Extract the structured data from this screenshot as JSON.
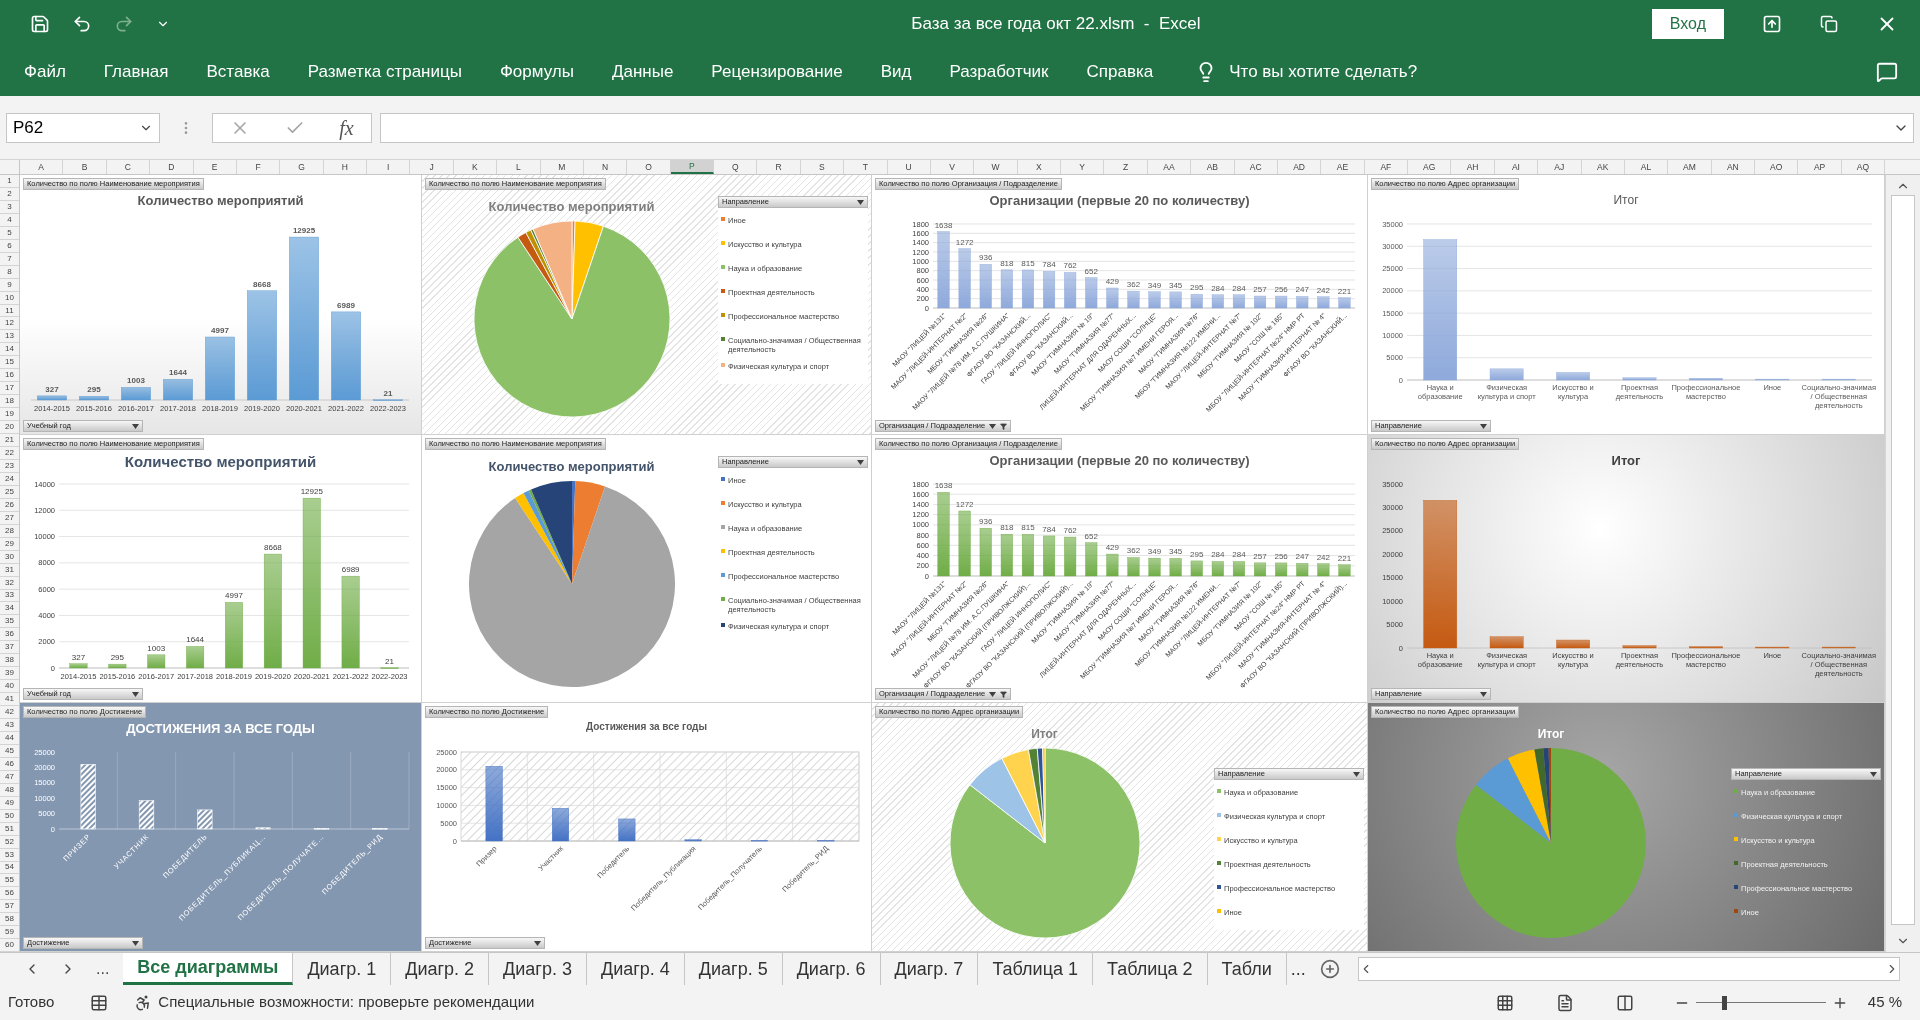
{
  "window": {
    "title": "База за все года окт 22.xlsm  -  Excel",
    "sign_in": "Вход"
  },
  "ribbon_tabs": [
    "Файл",
    "Главная",
    "Вставка",
    "Разметка страницы",
    "Формулы",
    "Данные",
    "Рецензирование",
    "Вид",
    "Разработчик",
    "Справка"
  ],
  "tell_me": "Что вы хотите сделать?",
  "name_box": "P62",
  "fx_label": "fx",
  "columns": [
    {
      "label": "A",
      "selected": false
    },
    {
      "label": "B",
      "selected": false
    },
    {
      "label": "C",
      "selected": false
    },
    {
      "label": "D",
      "selected": false
    },
    {
      "label": "E",
      "selected": false
    },
    {
      "label": "F",
      "selected": false
    },
    {
      "label": "G",
      "selected": false
    },
    {
      "label": "H",
      "selected": false
    },
    {
      "label": "I",
      "selected": false
    },
    {
      "label": "J",
      "selected": false
    },
    {
      "label": "K",
      "selected": false
    },
    {
      "label": "L",
      "selected": false
    },
    {
      "label": "M",
      "selected": false
    },
    {
      "label": "N",
      "selected": false
    },
    {
      "label": "O",
      "selected": false
    },
    {
      "label": "P",
      "selected": true
    },
    {
      "label": "Q",
      "selected": false
    },
    {
      "label": "R",
      "selected": false
    },
    {
      "label": "S",
      "selected": false
    },
    {
      "label": "T",
      "selected": false
    },
    {
      "label": "U",
      "selected": false
    },
    {
      "label": "V",
      "selected": false
    },
    {
      "label": "W",
      "selected": false
    },
    {
      "label": "X",
      "selected": false
    },
    {
      "label": "Y",
      "selected": false
    },
    {
      "label": "Z",
      "selected": false
    },
    {
      "label": "AA",
      "selected": false
    },
    {
      "label": "AB",
      "selected": false
    },
    {
      "label": "AC",
      "selected": false
    },
    {
      "label": "AD",
      "selected": false
    },
    {
      "label": "AE",
      "selected": false
    },
    {
      "label": "AF",
      "selected": false
    },
    {
      "label": "AG",
      "selected": false
    },
    {
      "label": "AH",
      "selected": false
    },
    {
      "label": "AI",
      "selected": false
    },
    {
      "label": "AJ",
      "selected": false
    },
    {
      "label": "AK",
      "selected": false
    },
    {
      "label": "AL",
      "selected": false
    },
    {
      "label": "AM",
      "selected": false
    },
    {
      "label": "AN",
      "selected": false
    },
    {
      "label": "AO",
      "selected": false
    },
    {
      "label": "AP",
      "selected": false
    },
    {
      "label": "AQ",
      "selected": false
    }
  ],
  "rows": [
    "1",
    "2",
    "3",
    "4",
    "5",
    "6",
    "7",
    "8",
    "9",
    "10",
    "11",
    "12",
    "13",
    "14",
    "15",
    "16",
    "17",
    "18",
    "19",
    "20",
    "21",
    "22",
    "23",
    "24",
    "25",
    "26",
    "27",
    "28",
    "29",
    "30",
    "31",
    "32",
    "33",
    "34",
    "35",
    "36",
    "37",
    "38",
    "39",
    "40",
    "41",
    "42",
    "43",
    "44",
    "45",
    "46",
    "47",
    "48",
    "49",
    "50",
    "51",
    "52",
    "53",
    "54",
    "55",
    "56",
    "57",
    "58",
    "59",
    "60"
  ],
  "charts": [
    {
      "kind": "yearbars",
      "field_button": "Количество по полю Наименование мероприятия",
      "title": "Количество мероприятий",
      "axis_button": "Учебный год",
      "chart_data": {
        "type": "bar",
        "categories": [
          "2014-2015",
          "2015-2016",
          "2016-2017",
          "2017-2018",
          "2018-2019",
          "2019-2020",
          "2020-2021",
          "2021-2022",
          "2022-2023"
        ],
        "series": [
          {
            "color": "#5b9bd5",
            "values": [
              327,
              295,
              1003,
              1644,
              4997,
              8668,
              12925,
              6989,
              21
            ]
          }
        ],
        "data_labels": true
      }
    },
    {
      "kind": "piewarm",
      "field_button": "Количество по полю Наименование мероприятия",
      "title": "Количество мероприятий",
      "legend": {
        "title": "Направление",
        "items": [
          {
            "label": "Иное",
            "color": "#ed7d31"
          },
          {
            "label": "Искусство и культура",
            "color": "#ffc000"
          },
          {
            "label": "Наука и образование",
            "color": "#8cc168"
          },
          {
            "label": "Проектная деятельность",
            "color": "#c55a11"
          },
          {
            "label": "Профессиональное мастерство",
            "color": "#bf9000"
          },
          {
            "label": "Социально-значимая / Общественная деятельность",
            "color": "#548235"
          },
          {
            "label": "Физическая культура и спорт",
            "color": "#f4b183"
          }
        ]
      }
    },
    {
      "kind": "orgbars",
      "field_button": "Количество по полю Организация / Подразделение",
      "title": "Организации (первые 20 по количеству)",
      "axis_button": "Организация / Подразделение",
      "chart_data": {
        "type": "bar",
        "categories": [
          "МАОУ \"ЛИЦЕЙ №131\"",
          "МАОУ \"ЛИЦЕЙ-ИНТЕРНАТ №2\"",
          "МБОУ \"ГИМНАЗИЯ №26\"",
          "МАОУ \"ЛИЦЕЙ №78 ИМ. А.С.ПУШКИНА\"",
          "ФГАОУ ВО \"КАЗАНСКИЙ...",
          "ГАОУ \"ЛИЦЕЙ ИННОПОЛИС\"",
          "ФГАОУ ВО \"КАЗАНСКИЙ...",
          "МАОУ \"ГИМНАЗИЯ № 19\"",
          "МАОУ \"ГИМНАЗИЯ №77\"",
          "ЛИЦЕЙ-ИНТЕРНАТ ДЛЯ ОДАРЕННЫХ...",
          "МАОУ СОШИ \"СОЛНЦЕ\"",
          "МБОУ \"ГИМНАЗИЯ №7 ИМЕНИ ГЕРОЯ...",
          "МАОУ \"ГИМНАЗИЯ №76\"",
          "МБОУ \"ГИМНАЗИЯ №122 ИМЕНИ...",
          "МАОУ \"ЛИЦЕЙ-ИНТЕРНАТ №7\"",
          "МБОУ \"ГИМНАЗИЯ № 102\"",
          "МАОУ \"СОШ № 165\"",
          "МБОУ \"ЛИЦЕЙ-ИНТЕРНАТ №24\" НМР РТ",
          "МАОУ \"ГИМНАЗИЯ-ИНТЕРНАТ № 4\"",
          "ФГАОУ ВО \"КАЗАНСКИЙ..."
        ],
        "series": [
          {
            "color": "#8ea9db",
            "values": [
              1638,
              1272,
              936,
              818,
              815,
              784,
              762,
              652,
              429,
              362,
              349,
              345,
              295,
              284,
              284,
              257,
              256,
              247,
              242,
              221
            ]
          }
        ],
        "ylim": [
          0,
          1800
        ],
        "yticks": [
          0,
          200,
          400,
          600,
          800,
          1000,
          1200,
          1400,
          1600,
          1800
        ],
        "grid": true,
        "data_labels": true
      }
    },
    {
      "kind": "totals",
      "field_button": "Количество по полю Адрес организации",
      "title": "Итог",
      "axis_button": "Направление",
      "chart_data": {
        "type": "bar",
        "categories": [
          "Наука и образование",
          "Физическая культура и спорт",
          "Искусство и культура",
          "Проектная деятельность",
          "Профессиональное мастерство",
          "Иное",
          "Социально-значимая / Общественная деятельность"
        ],
        "series": [
          {
            "color": "#8ea9db",
            "values": [
              31500,
              2500,
              1700,
              500,
              400,
              200,
              200
            ]
          }
        ],
        "ylim": [
          0,
          35000
        ],
        "yticks": [
          0,
          5000,
          10000,
          15000,
          20000,
          25000,
          30000,
          35000
        ],
        "grid": true
      }
    },
    {
      "kind": "yeargrid",
      "field_button": "Количество по полю Наименование мероприятия",
      "title": "Количество мероприятий",
      "axis_button": "Учебный год",
      "chart_data": {
        "type": "bar",
        "categories": [
          "2014-2015",
          "2015-2016",
          "2016-2017",
          "2017-2018",
          "2018-2019",
          "2019-2020",
          "2020-2021",
          "2021-2022",
          "2022-2023"
        ],
        "series": [
          {
            "color": "#70ad47",
            "values": [
              327,
              295,
              1003,
              1644,
              4997,
              8668,
              12925,
              6989,
              21
            ]
          }
        ],
        "ylim": [
          0,
          14000
        ],
        "yticks": [
          0,
          2000,
          4000,
          6000,
          8000,
          10000,
          12000,
          14000
        ],
        "grid": true,
        "data_labels": true
      }
    },
    {
      "kind": "piegray",
      "field_button": "Количество по полю Наименование мероприятия",
      "title": "Количество мероприятий",
      "legend": {
        "title": "Направление",
        "items": [
          {
            "label": "Иное",
            "color": "#4472c4"
          },
          {
            "label": "Искусство и культура",
            "color": "#ed7d31"
          },
          {
            "label": "Наука и образование",
            "color": "#a5a5a5"
          },
          {
            "label": "Проектная деятельность",
            "color": "#ffc000"
          },
          {
            "label": "Профессиональное мастерство",
            "color": "#5b9bd5"
          },
          {
            "label": "Социально-значимая / Общественная деятельность",
            "color": "#70ad47"
          },
          {
            "label": "Физическая культура и спорт",
            "color": "#264478"
          }
        ]
      }
    },
    {
      "kind": "orgbars",
      "field_button": "Количество по полю Организация / Подразделение",
      "title": "Организации (первые 20 по количеству)",
      "axis_button": "Организация / Подразделение",
      "chart_data": {
        "type": "bar",
        "categories": [
          "МАОУ \"ЛИЦЕЙ №131\"",
          "МАОУ \"ЛИЦЕЙ-ИНТЕРНАТ №2\"",
          "МБОУ \"ГИМНАЗИЯ №26\"",
          "МАОУ \"ЛИЦЕЙ №78 ИМ. А.С.ПУШКИНА\"",
          "ФГАОУ ВО \"КАЗАНСКИЙ (ПРИВОЛЖСКИЙ)...",
          "ГАОУ \"ЛИЦЕЙ ИННОПОЛИС\"",
          "ФГАОУ ВО \"КАЗАНСКИЙ (ПРИВОЛЖСКИЙ)...",
          "МАОУ \"ГИМНАЗИЯ № 19\"",
          "МАОУ \"ГИМНАЗИЯ №77\"",
          "ЛИЦЕЙ-ИНТЕРНАТ ДЛЯ ОДАРЕННЫХ...",
          "МАОУ СОШИ \"СОЛНЦЕ\"",
          "МБОУ \"ГИМНАЗИЯ №7 ИМЕНИ ГЕРОЯ...",
          "МАОУ \"ГИМНАЗИЯ №76\"",
          "МБОУ \"ГИМНАЗИЯ №122 ИМЕНИ...",
          "МАОУ \"ЛИЦЕЙ-ИНТЕРНАТ №7\"",
          "МБОУ \"ГИМНАЗИЯ № 102\"",
          "МАОУ \"СОШ № 165\"",
          "МБОУ \"ЛИЦЕЙ-ИНТЕРНАТ №24\" НМР РТ",
          "МАОУ \"ГИМНАЗИЯ-ИНТЕРНАТ № 4\"",
          "ФГАОУ ВО \"КАЗАНСКИЙ (ПРИВОЛЖСКИЙ)..."
        ],
        "series": [
          {
            "color": "#70ad47",
            "values": [
              1638,
              1272,
              936,
              818,
              815,
              784,
              762,
              652,
              429,
              362,
              349,
              345,
              295,
              284,
              284,
              257,
              256,
              247,
              242,
              221
            ]
          }
        ],
        "ylim": [
          0,
          1800
        ],
        "yticks": [
          0,
          200,
          400,
          600,
          800,
          1000,
          1200,
          1400,
          1600,
          1800
        ],
        "grid": true,
        "data_labels": true
      }
    },
    {
      "kind": "totalsshaded",
      "field_button": "Количество по полю Адрес организации",
      "title": "Итог",
      "axis_button": "Направление",
      "chart_data": {
        "type": "bar",
        "categories": [
          "Наука и образование",
          "Физическая культура и спорт",
          "Искусство и культура",
          "Проектная деятельность",
          "Профессиональное мастерство",
          "Иное",
          "Социально-значимая / Общественная деятельность"
        ],
        "series": [
          {
            "color": "#c55a11",
            "values": [
              31500,
              2400,
              1700,
              500,
              300,
              200,
              200
            ]
          }
        ],
        "ylim": [
          0,
          35000
        ],
        "yticks": [
          0,
          5000,
          10000,
          15000,
          20000,
          25000,
          30000,
          35000
        ]
      }
    },
    {
      "kind": "slate",
      "field_button": "Количество по полю Достижение",
      "title": "ДОСТИЖЕНИЯ ЗА ВСЕ ГОДЫ",
      "axis_button": "Достижение",
      "chart_data": {
        "type": "bar",
        "categories": [
          "ПРИЗЕР",
          "УЧАСТНИК",
          "ПОБЕДИТЕЛЬ",
          "ПОБЕДИТЕЛЬ_ПУБЛИКАЦ…",
          "ПОБЕДИТЕЛЬ_ПОЛУЧАТЕ…",
          "ПОБЕДИТЕЛЬ_РИД"
        ],
        "series": [
          {
            "color": "#ffffff",
            "values": [
              21000,
              9200,
              6200,
              400,
              200,
              200
            ]
          }
        ],
        "ylim": [
          0,
          25000
        ],
        "yticks": [
          0,
          5000,
          10000,
          15000,
          20000,
          25000
        ]
      }
    },
    {
      "kind": "hatchgrid",
      "field_button": "Количество по полю Достижение",
      "title": "Достижения за все годы",
      "axis_button": "Достижение",
      "chart_data": {
        "type": "bar",
        "categories": [
          "Призер",
          "Участник",
          "Победитель",
          "Победитель_Публикация",
          "Победитель_Получатель",
          "Победитель_РИД"
        ],
        "series": [
          {
            "color": "#4472c4",
            "values": [
              21000,
              9200,
              6200,
              400,
              200,
              200
            ]
          }
        ],
        "ylim": [
          0,
          25000
        ],
        "yticks": [
          0,
          5000,
          10000,
          15000,
          20000,
          25000
        ],
        "grid": true
      }
    },
    {
      "kind": "piestriped",
      "field_button": "Количество по полю Адрес организации",
      "title": "Итог",
      "legend": {
        "title": "Направление",
        "items": [
          {
            "label": "Наука и образование",
            "color": "#8cc168"
          },
          {
            "label": "Физическая культура и спорт",
            "color": "#9dc3e6"
          },
          {
            "label": "Искусство и культура",
            "color": "#ffd34d"
          },
          {
            "label": "Проектная деятельность",
            "color": "#548235"
          },
          {
            "label": "Профессиональное мастерство",
            "color": "#2f5597"
          },
          {
            "label": "Иное",
            "color": "#ffc000"
          }
        ]
      }
    },
    {
      "kind": "piedark",
      "field_button": "Количество по полю Адрес организации",
      "title": "Итог",
      "legend": {
        "title": "Направление",
        "items": [
          {
            "label": "Наука и образование",
            "color": "#70ad47"
          },
          {
            "label": "Физическая культура и спорт",
            "color": "#5b9bd5"
          },
          {
            "label": "Искусство и культура",
            "color": "#ffc000"
          },
          {
            "label": "Проектная деятельность",
            "color": "#43682b"
          },
          {
            "label": "Профессиональное мастерство",
            "color": "#264478"
          },
          {
            "label": "Иное",
            "color": "#9e480e"
          }
        ]
      }
    }
  ],
  "sheet_tabs_more": "...",
  "sheet_tabs": [
    {
      "label": "Все диаграммы",
      "selected": true
    },
    {
      "label": "Диагр. 1",
      "selected": false
    },
    {
      "label": "Диагр. 2",
      "selected": false
    },
    {
      "label": "Диагр. 3",
      "selected": false
    },
    {
      "label": "Диагр. 4",
      "selected": false
    },
    {
      "label": "Диагр. 5",
      "selected": false
    },
    {
      "label": "Диагр. 6",
      "selected": false
    },
    {
      "label": "Диагр. 7",
      "selected": false
    },
    {
      "label": "Таблица 1",
      "selected": false
    },
    {
      "label": "Таблица 2",
      "selected": false
    },
    {
      "label": "Табли",
      "selected": false
    }
  ],
  "sheet_tabs_more_right": "...",
  "status": {
    "ready": "Готово",
    "accessibility": "Специальные возможности: проверьте рекомендации",
    "zoom": {
      "level": 0.2,
      "reading": "45 %"
    }
  }
}
